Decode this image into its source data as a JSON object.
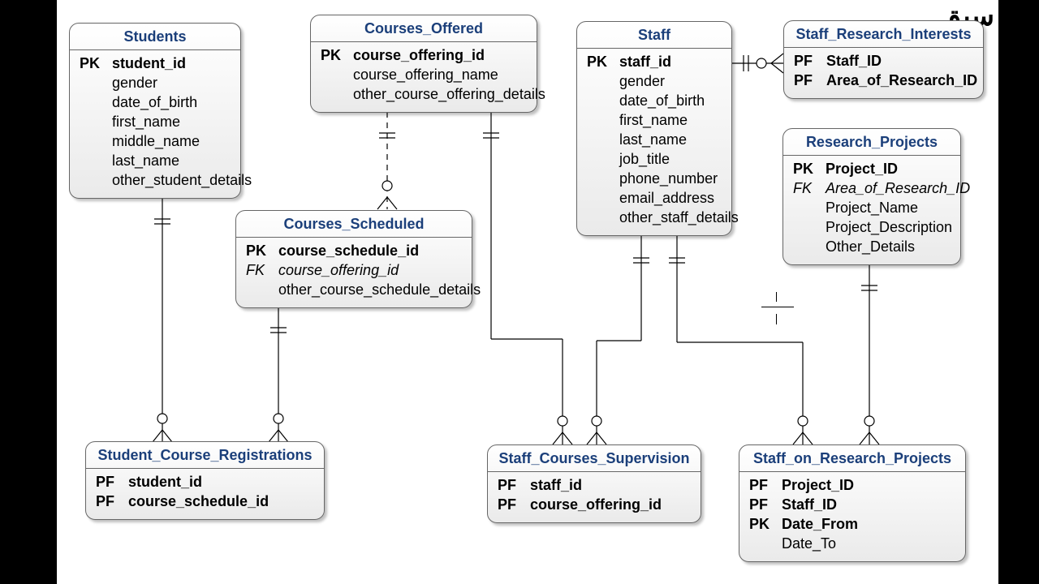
{
  "watermark": "سبق",
  "entities": {
    "students": {
      "title": "Students",
      "rows": [
        {
          "key": "PK",
          "name": "student_id",
          "pk": true
        },
        {
          "key": "",
          "name": "gender"
        },
        {
          "key": "",
          "name": "date_of_birth"
        },
        {
          "key": "",
          "name": "first_name"
        },
        {
          "key": "",
          "name": "middle_name"
        },
        {
          "key": "",
          "name": "last_name"
        },
        {
          "key": "",
          "name": "other_student_details"
        }
      ]
    },
    "courses_offered": {
      "title": "Courses_Offered",
      "rows": [
        {
          "key": "PK",
          "name": "course_offering_id",
          "pk": true
        },
        {
          "key": "",
          "name": "course_offering_name"
        },
        {
          "key": "",
          "name": "other_course_offering_details"
        }
      ]
    },
    "staff": {
      "title": "Staff",
      "rows": [
        {
          "key": "PK",
          "name": "staff_id",
          "pk": true
        },
        {
          "key": "",
          "name": "gender"
        },
        {
          "key": "",
          "name": "date_of_birth"
        },
        {
          "key": "",
          "name": "first_name"
        },
        {
          "key": "",
          "name": "last_name"
        },
        {
          "key": "",
          "name": "job_title"
        },
        {
          "key": "",
          "name": "phone_number"
        },
        {
          "key": "",
          "name": "email_address"
        },
        {
          "key": "",
          "name": "other_staff_details"
        }
      ]
    },
    "staff_research_interests": {
      "title": "Staff_Research_Interests",
      "rows": [
        {
          "key": "PF",
          "name": "Staff_ID",
          "pk": true
        },
        {
          "key": "PF",
          "name": "Area_of_Research_ID",
          "pk": true
        }
      ]
    },
    "research_projects": {
      "title": "Research_Projects",
      "rows": [
        {
          "key": "PK",
          "name": "Project_ID",
          "pk": true
        },
        {
          "key": "FK",
          "name": "Area_of_Research_ID",
          "fk": true
        },
        {
          "key": "",
          "name": "Project_Name"
        },
        {
          "key": "",
          "name": "Project_Description"
        },
        {
          "key": "",
          "name": "Other_Details"
        }
      ]
    },
    "courses_scheduled": {
      "title": "Courses_Scheduled",
      "rows": [
        {
          "key": "PK",
          "name": "course_schedule_id",
          "pk": true
        },
        {
          "key": "FK",
          "name": "course_offering_id",
          "fk": true
        },
        {
          "key": "",
          "name": "other_course_schedule_details"
        }
      ]
    },
    "student_course_registrations": {
      "title": "Student_Course_Registrations",
      "rows": [
        {
          "key": "PF",
          "name": "student_id",
          "pk": true
        },
        {
          "key": "PF",
          "name": "course_schedule_id",
          "pk": true
        }
      ]
    },
    "staff_courses_supervision": {
      "title": "Staff_Courses_Supervision",
      "rows": [
        {
          "key": "PF",
          "name": "staff_id",
          "pk": true
        },
        {
          "key": "PF",
          "name": "course_offering_id",
          "pk": true
        }
      ]
    },
    "staff_on_research_projects": {
      "title": "Staff_on_Research_Projects",
      "rows": [
        {
          "key": "PF",
          "name": "Project_ID",
          "pk": true
        },
        {
          "key": "PF",
          "name": "Staff_ID",
          "pk": true
        },
        {
          "key": "PK",
          "name": "Date_From",
          "pk": true
        },
        {
          "key": "",
          "name": "Date_To"
        }
      ]
    }
  }
}
